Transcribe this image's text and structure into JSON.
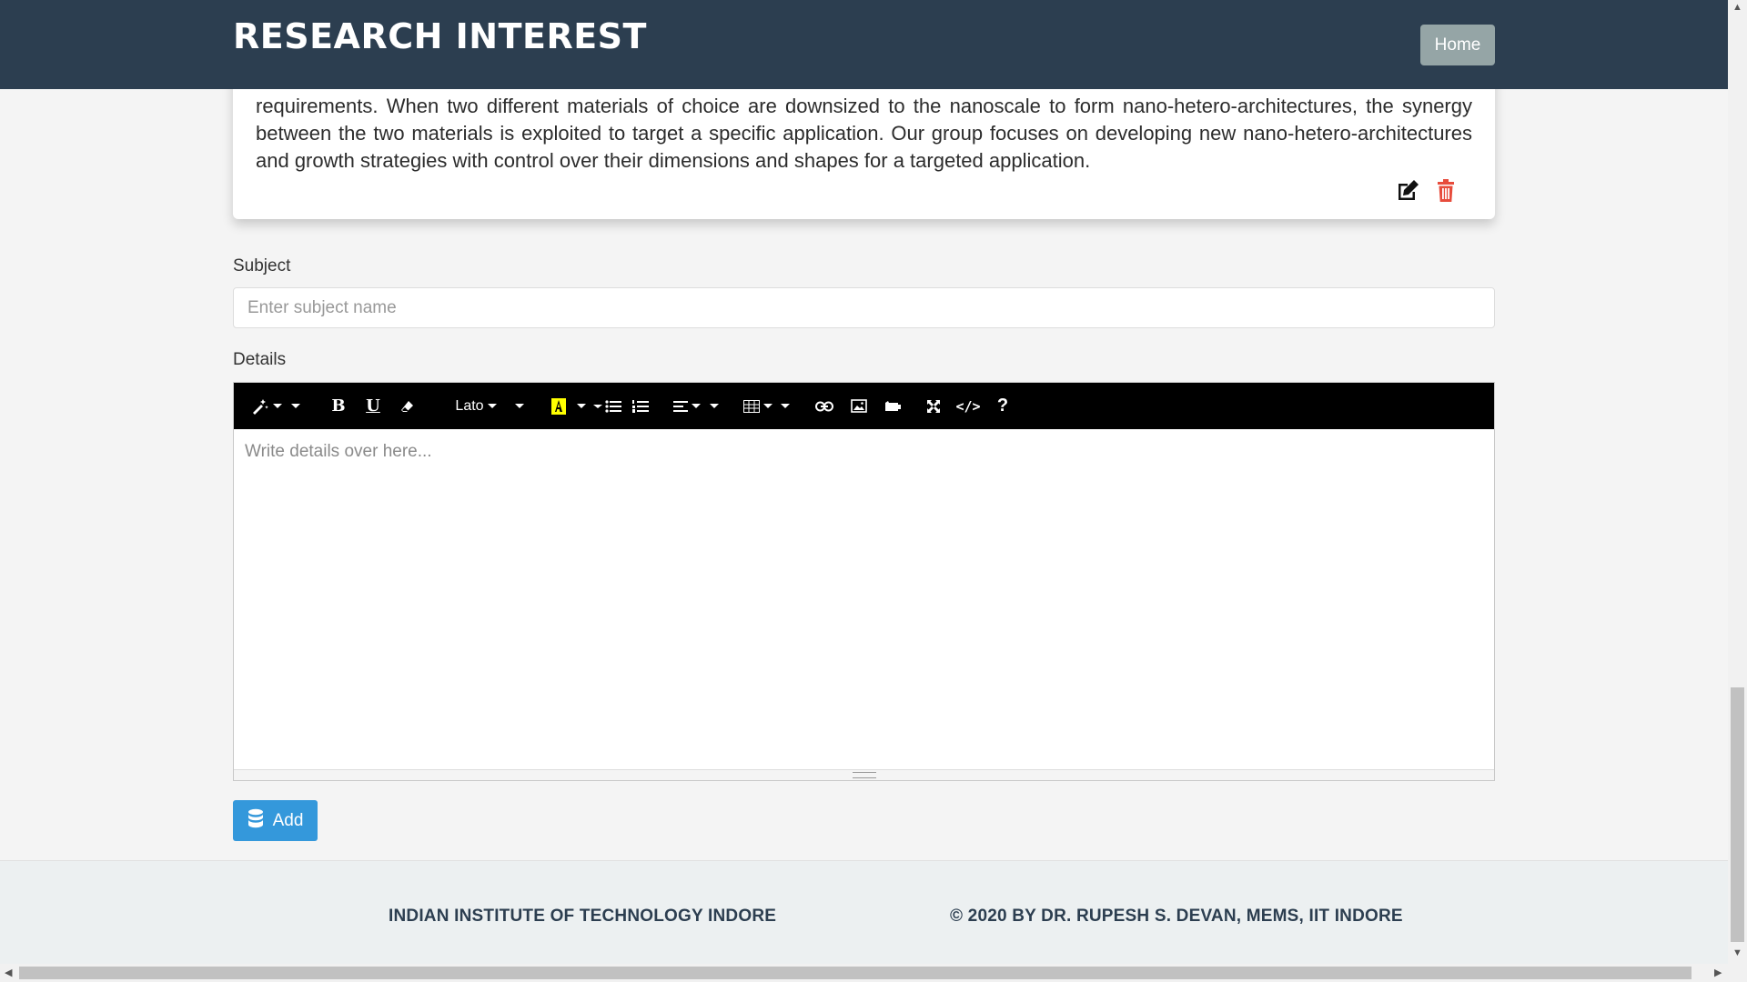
{
  "navbar": {
    "title": "RESEARCH INTEREST",
    "home_label": "Home"
  },
  "card": {
    "text": "requirements. When two different materials of choice are downsized to the nanoscale to form nano-hetero-architectures, the synergy between the two materials is exploited to target a specific application. Our group focuses on developing new nano-hetero-architectures and growth strategies with control over their dimensions and shapes for a targeted application.",
    "edit_icon": "edit-icon",
    "delete_icon": "trash-icon",
    "delete_color": "#e74c3c"
  },
  "form": {
    "subject_label": "Subject",
    "subject_placeholder": "Enter subject name",
    "details_label": "Details",
    "details_placeholder": "Write details over here...",
    "add_label": "Add"
  },
  "toolbar": {
    "font_name": "Lato",
    "highlight_color": "#ffff00",
    "help": "?"
  },
  "footer": {
    "left": "INDIAN INSTITUTE OF TECHNOLOGY INDORE",
    "right": "© 2020 BY DR. RUPESH S. DEVAN, MEMS, IIT INDORE"
  },
  "colors": {
    "navbar": "#2c3e50",
    "accent": "#3498db",
    "home": "#95a5a6"
  }
}
